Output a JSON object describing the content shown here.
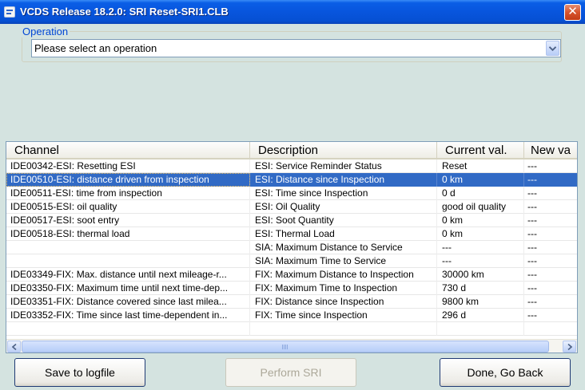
{
  "window": {
    "title": "VCDS Release 18.2.0:  SRI Reset-SRI1.CLB",
    "close_glyph": "✕"
  },
  "operation": {
    "legend": "Operation",
    "selected": "Please select an operation"
  },
  "table": {
    "columns": [
      "Channel",
      "Description",
      "Current val.",
      "New va"
    ],
    "rows": [
      {
        "channel": "IDE00342-ESI: Resetting ESI",
        "description": "ESI: Service Reminder Status",
        "current": "Reset",
        "new": "---",
        "selected": false
      },
      {
        "channel": "IDE00510-ESI: distance driven from inspection",
        "description": "ESI: Distance since Inspection",
        "current": "0 km",
        "new": "---",
        "selected": true
      },
      {
        "channel": "IDE00511-ESI: time from inspection",
        "description": "ESI: Time since Inspection",
        "current": "0 d",
        "new": "---",
        "selected": false
      },
      {
        "channel": "IDE00515-ESI: oil quality",
        "description": "ESI: Oil Quality",
        "current": "good oil quality",
        "new": "---",
        "selected": false
      },
      {
        "channel": "IDE00517-ESI: soot entry",
        "description": "ESI: Soot Quantity",
        "current": "0 km",
        "new": "---",
        "selected": false
      },
      {
        "channel": "IDE00518-ESI: thermal load",
        "description": "ESI: Thermal Load",
        "current": "0 km",
        "new": "---",
        "selected": false
      },
      {
        "channel": "",
        "description": "SIA: Maximum Distance to Service",
        "current": "---",
        "new": "---",
        "selected": false
      },
      {
        "channel": "",
        "description": "SIA: Maximum Time to Service",
        "current": "---",
        "new": "---",
        "selected": false
      },
      {
        "channel": "IDE03349-FIX: Max. distance until next mileage-r...",
        "description": "FIX: Maximum Distance to Inspection",
        "current": "30000 km",
        "new": "---",
        "selected": false
      },
      {
        "channel": "IDE03350-FIX: Maximum time until next time-dep...",
        "description": "FIX: Maximum Time to Inspection",
        "current": "730 d",
        "new": "---",
        "selected": false
      },
      {
        "channel": "IDE03351-FIX: Distance covered since last milea...",
        "description": "FIX: Distance since Inspection",
        "current": "9800 km",
        "new": "---",
        "selected": false
      },
      {
        "channel": "IDE03352-FIX: Time since last time-dependent in...",
        "description": "FIX: Time since Inspection",
        "current": "296 d",
        "new": "---",
        "selected": false
      },
      {
        "channel": "",
        "description": "",
        "current": "",
        "new": "",
        "selected": false
      }
    ]
  },
  "buttons": {
    "save": "Save to logfile",
    "perform": "Perform SRI",
    "done": "Done, Go Back"
  }
}
